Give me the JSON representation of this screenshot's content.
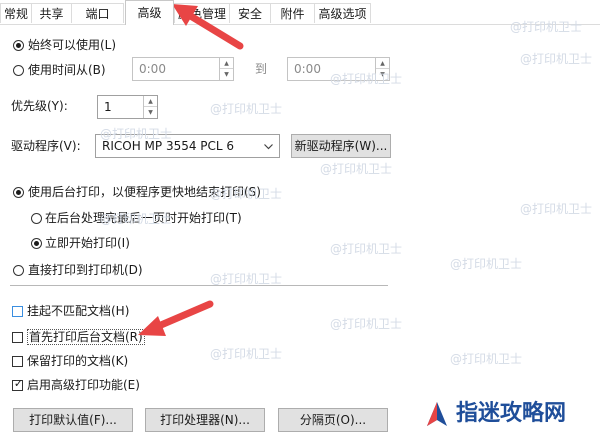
{
  "tabs": [
    "常规",
    "共享",
    "端口",
    "高级",
    "颜色管理",
    "安全",
    "附件",
    "高级选项"
  ],
  "availability": {
    "always": "始终可以使用(L)",
    "time_from": "使用时间从(B)",
    "from_value": "0:00",
    "to_label": "到",
    "to_value": "0:00"
  },
  "priority": {
    "label": "优先级(Y):",
    "value": "1"
  },
  "driver": {
    "label": "驱动程序(V):",
    "value": "RICOH MP 3554 PCL 6",
    "new_button": "新驱动程序(W)..."
  },
  "spool": {
    "use_spool": "使用后台打印，以便程序更快地结束打印(S)",
    "after_last_page": "在后台处理完最后一页时开始打印(T)",
    "immediately": "立即开始打印(I)",
    "direct": "直接打印到打印机(D)"
  },
  "options": {
    "hold_mismatched": "挂起不匹配文档(H)",
    "print_spooled_first": "首先打印后台文档(R)",
    "keep_printed": "保留打印的文档(K)",
    "advanced_features": "启用高级打印功能(E)"
  },
  "buttons": {
    "defaults": "打印默认值(F)...",
    "processor": "打印处理器(N)...",
    "separator": "分隔页(O)..."
  },
  "watermark": {
    "text": "@打印机卫士",
    "logo_text": "指迷攻略网",
    "logo_color": "#1f4e9a"
  },
  "colors": {
    "arrow": "#e84545",
    "check_highlight": "#3a8ee0"
  }
}
